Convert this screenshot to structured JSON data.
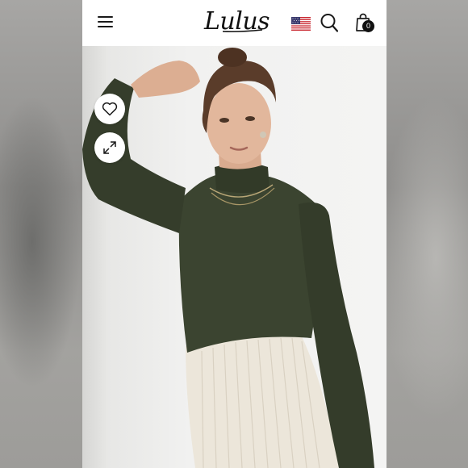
{
  "header": {
    "logo_text": "Lulus",
    "cart_count": "0",
    "icons": [
      "menu-icon",
      "us-flag-icon",
      "search-icon",
      "shopping-bag-icon"
    ]
  },
  "product_image": {
    "actions": [
      "heart-icon",
      "expand-icon"
    ],
    "top_color": "#3b4430",
    "skirt_color": "#ece6da",
    "background_color": "#f2f2f1"
  },
  "colors": {
    "header_bg": "#ffffff",
    "icon": "#1a1a1a",
    "badge": "#111111"
  }
}
